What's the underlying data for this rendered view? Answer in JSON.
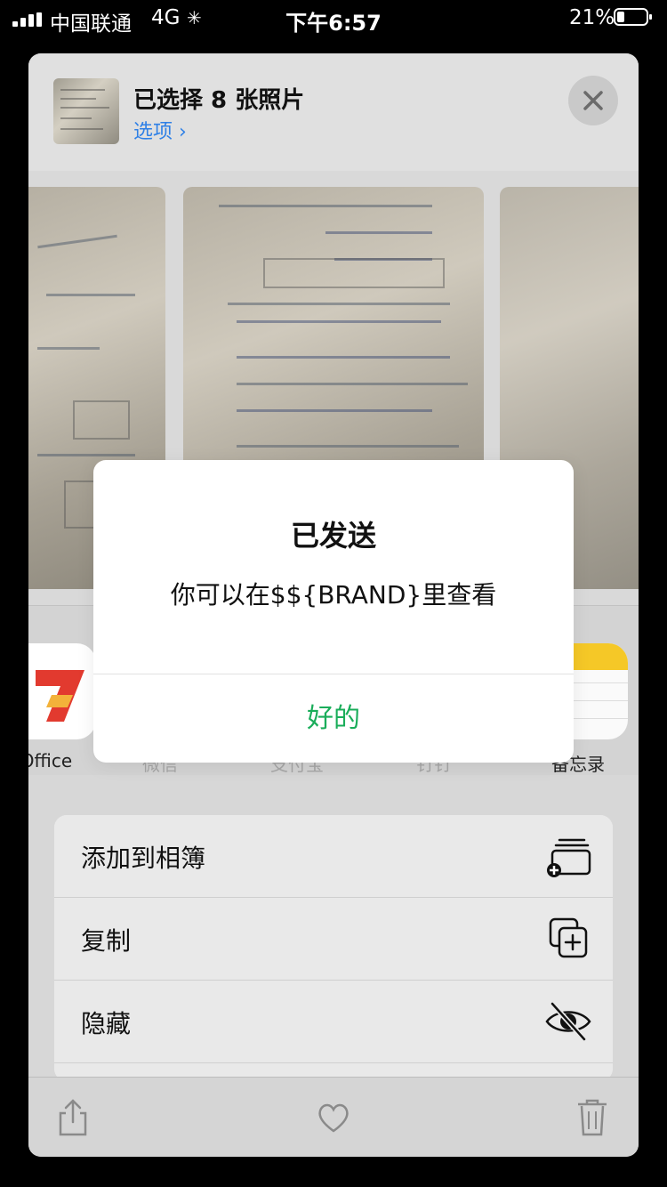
{
  "status_bar": {
    "carrier": "中国联通",
    "network": "4G",
    "time": "下午6:57",
    "battery_percent": "21%"
  },
  "share_sheet": {
    "title": "已选择 8 张照片",
    "options_label": "选项 ›",
    "apps": [
      {
        "label": "Office",
        "icon": "office-app-icon"
      },
      {
        "label": "微信",
        "icon": "wechat-app-icon"
      },
      {
        "label": "支付宝",
        "icon": "alipay-app-icon"
      },
      {
        "label": "钉钉",
        "icon": "dingtalk-app-icon"
      },
      {
        "label": "备忘录",
        "icon": "notes-app-icon"
      }
    ],
    "actions": [
      {
        "label": "添加到相簿",
        "icon": "add-to-album-icon"
      },
      {
        "label": "复制",
        "icon": "copy-icon"
      },
      {
        "label": "隐藏",
        "icon": "hide-eye-slash-icon"
      }
    ]
  },
  "alert": {
    "title": "已发送",
    "message": "你可以在$${BRAND}里查看",
    "button_label": "好的"
  },
  "colors": {
    "link_blue": "#2f80e6",
    "confirm_green": "#1aad5a"
  }
}
